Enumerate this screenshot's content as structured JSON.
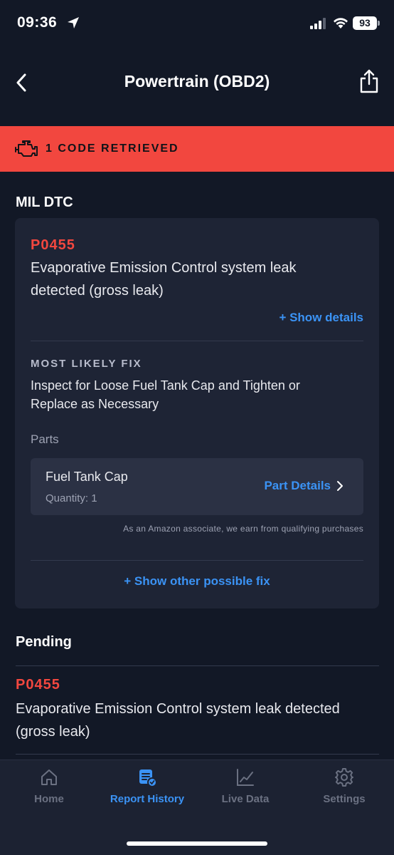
{
  "status_bar": {
    "time": "09:36",
    "battery": "93"
  },
  "header": {
    "title": "Powertrain (OBD2)",
    "back_icon": "chevron-left-icon",
    "share_icon": "share-icon"
  },
  "banner": {
    "icon": "check-engine-icon",
    "text": "1 CODE RETRIEVED",
    "color": "#f2473f"
  },
  "mil_section": {
    "heading": "MIL DTC",
    "code": "P0455",
    "description": "Evaporative Emission Control system leak detected (gross leak)",
    "show_details": "+ Show details",
    "fix_heading": "MOST LIKELY FIX",
    "fix_text": "Inspect for Loose Fuel Tank Cap and Tighten or Replace as Necessary",
    "parts_label": "Parts",
    "part": {
      "name": "Fuel Tank Cap",
      "quantity": "Quantity: 1",
      "details_link": "Part Details"
    },
    "amazon_note": "As an Amazon associate, we earn from qualifying purchases",
    "show_other_fix": "+ Show other possible fix"
  },
  "pending_section": {
    "heading": "Pending",
    "code": "P0455",
    "description": "Evaporative Emission Control system leak detected (gross leak)"
  },
  "tab_bar": {
    "tabs": [
      {
        "label": "Home",
        "icon": "home-icon",
        "active": false
      },
      {
        "label": "Report History",
        "icon": "report-history-icon",
        "active": true
      },
      {
        "label": "Live Data",
        "icon": "live-data-chart-icon",
        "active": false
      },
      {
        "label": "Settings",
        "icon": "gear-icon",
        "active": false
      }
    ]
  },
  "colors": {
    "background": "#121826",
    "card": "#1e2435",
    "accent_blue": "#3b93f5",
    "code_red": "#f2473f"
  }
}
